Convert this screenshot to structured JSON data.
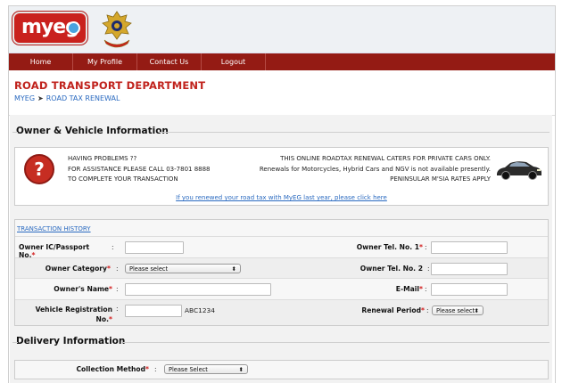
{
  "brand": {
    "logo_text": "myeg"
  },
  "nav": {
    "items": [
      "Home",
      "My Profile",
      "Contact Us",
      "Logout"
    ]
  },
  "page": {
    "title": "ROAD TRANSPORT DEPARTMENT",
    "breadcrumb": [
      "MYEG",
      "ROAD TAX RENEWAL"
    ]
  },
  "owner_section": {
    "heading": "Owner & Vehicle Information",
    "help_lines": [
      "HAVING PROBLEMS ??",
      "FOR ASSISTANCE PLEASE CALL 03-7801 8888",
      "TO COMPLETE YOUR TRANSACTION"
    ],
    "notice_lines": [
      "THIS ONLINE ROADTAX RENEWAL CATERS FOR PRIVATE CARS ONLY.",
      "Renewals for Motorcycles, Hybrid Cars and NGV is not available presently.",
      "PENINSULAR M'SIA RATES APPLY"
    ],
    "renew_link": "If you renewed your road tax with MyEG last year, please click here",
    "history_link": "TRANSACTION HISTORY"
  },
  "form": {
    "ic_label": "Owner IC/Passport No.",
    "tel1_label": "Owner Tel. No. 1",
    "category_label": "Owner Category",
    "category_value": "Please select",
    "tel2_label": "Owner Tel. No. 2",
    "name_label": "Owner's Name",
    "email_label": "E-Mail",
    "reg_label_1": "Vehicle Registration",
    "reg_label_2": "No.",
    "reg_value": "ABC1234",
    "period_label": "Renewal Period",
    "period_value": "Please select",
    "colon": ":",
    "required_mark": "*"
  },
  "delivery_section": {
    "heading": "Delivery Information",
    "collection_label": "Collection Method",
    "collection_value": "Please Select"
  },
  "icons": {
    "help": "question-icon",
    "car": "car-icon",
    "crest": "jpj-crest-icon"
  },
  "colors": {
    "nav_bg": "#941b14",
    "title": "#c0221c",
    "link": "#2a6ac0",
    "required": "#d21b1b"
  }
}
